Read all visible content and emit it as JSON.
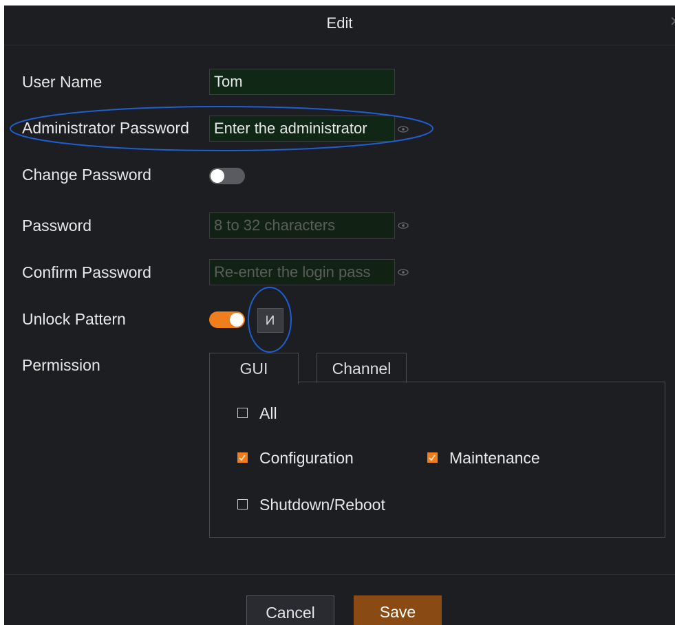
{
  "dialog": {
    "title": "Edit",
    "close_icon": "close-icon"
  },
  "form": {
    "user_name": {
      "label": "User Name",
      "value": "Tom"
    },
    "admin_password": {
      "label": "Administrator Password",
      "placeholder": "Enter the administrator",
      "icon": "eye-icon"
    },
    "change_password": {
      "label": "Change Password",
      "enabled": false
    },
    "password": {
      "label": "Password",
      "placeholder": "8 to 32 characters",
      "icon": "eye-icon"
    },
    "confirm_password": {
      "label": "Confirm Password",
      "placeholder": "Re-enter the login pass",
      "icon": "eye-icon"
    },
    "unlock_pattern": {
      "label": "Unlock Pattern",
      "enabled": true,
      "edit_icon": "pattern-edit-icon"
    },
    "permission": {
      "label": "Permission",
      "tabs": [
        {
          "label": "GUI",
          "active": true
        },
        {
          "label": "Channel",
          "active": false
        }
      ],
      "options": [
        {
          "label": "All",
          "checked": false
        },
        {
          "label": "Configuration",
          "checked": true
        },
        {
          "label": "Maintenance",
          "checked": true
        },
        {
          "label": "Shutdown/Reboot",
          "checked": false
        }
      ]
    }
  },
  "footer": {
    "cancel_label": "Cancel",
    "save_label": "Save"
  },
  "colors": {
    "background": "#1d1e22",
    "accent": "#f07e1c",
    "save_button": "#8a4a14",
    "annotation": "#1f5fd0"
  }
}
